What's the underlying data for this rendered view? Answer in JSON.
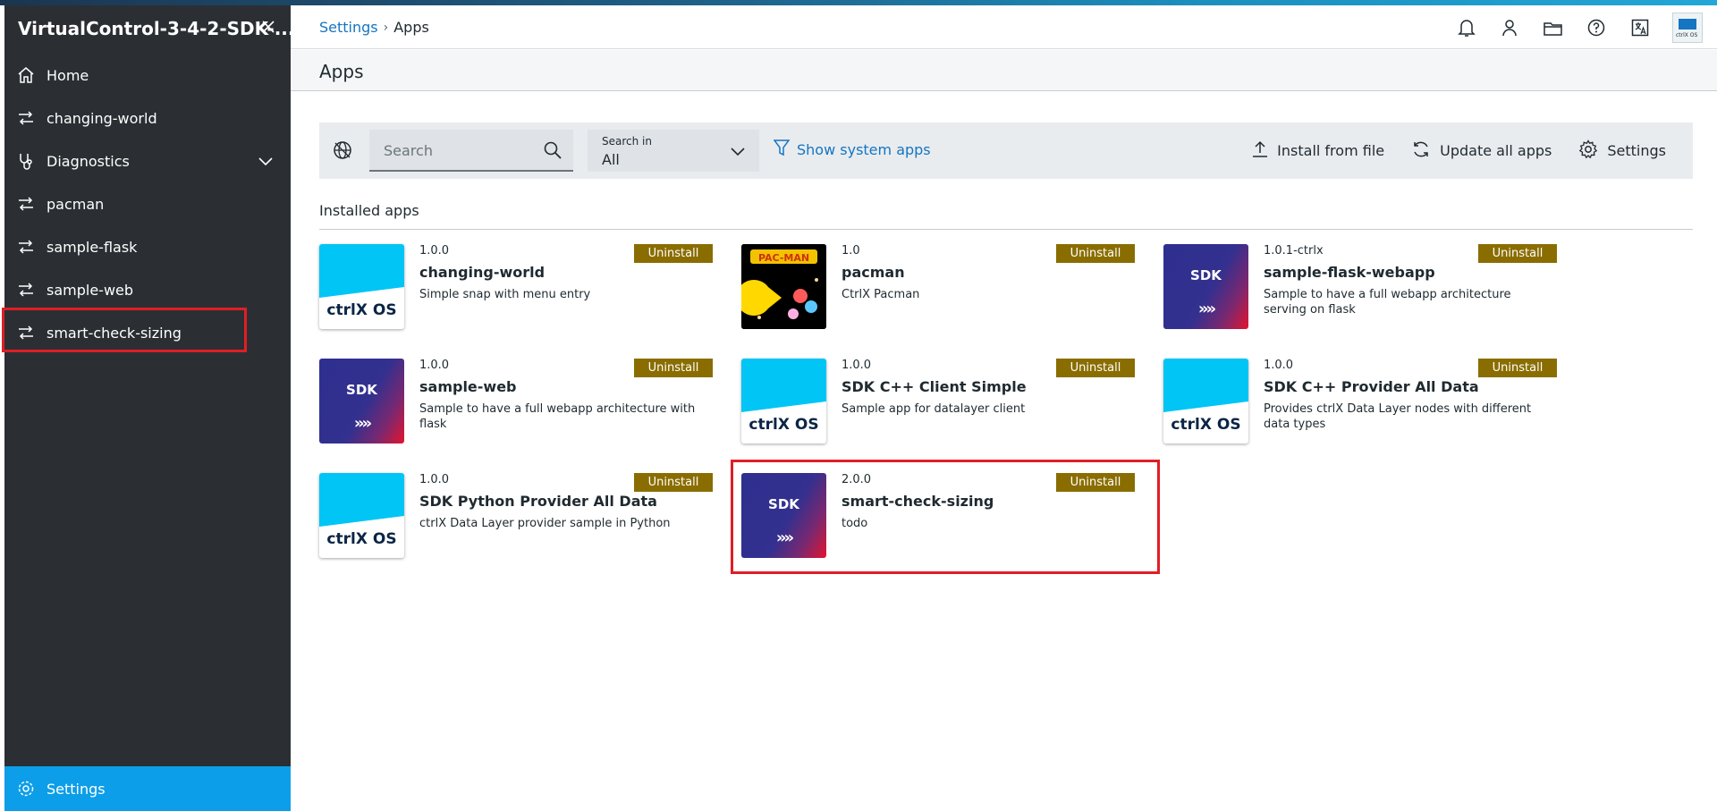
{
  "sidebar": {
    "title": "VirtualControl-3-4-2-SDK-...",
    "items": [
      {
        "label": "Home",
        "icon": "home-icon"
      },
      {
        "label": "changing-world",
        "icon": "app-icon"
      },
      {
        "label": "Diagnostics",
        "icon": "diagnostics-icon"
      },
      {
        "label": "pacman",
        "icon": "app-icon"
      },
      {
        "label": "sample-flask",
        "icon": "app-icon"
      },
      {
        "label": "sample-web",
        "icon": "app-icon"
      },
      {
        "label": "smart-check-sizing",
        "icon": "app-icon"
      }
    ],
    "settings_label": "Settings"
  },
  "header": {
    "breadcrumb_parent": "Settings",
    "breadcrumb_current": "Apps",
    "brand_text": "ctrlX OS"
  },
  "page": {
    "title": "Apps"
  },
  "toolbar": {
    "search_placeholder": "Search",
    "search_in_caption": "Search in",
    "search_in_value": "All",
    "show_system_apps": "Show system apps",
    "install_from_file": "Install from file",
    "update_all_apps": "Update all apps",
    "settings": "Settings"
  },
  "installed": {
    "heading": "Installed apps",
    "uninstall_label": "Uninstall",
    "apps": [
      {
        "version": "1.0.0",
        "name": "changing-world",
        "description": "Simple snap with menu entry",
        "logo": "ctrlx"
      },
      {
        "version": "1.0",
        "name": "pacman",
        "description": "CtrlX Pacman",
        "logo": "pacman"
      },
      {
        "version": "1.0.1-ctrlx",
        "name": "sample-flask-webapp",
        "description": "Sample to have a full webapp architecture serving on flask",
        "logo": "sdk"
      },
      {
        "version": "1.0.0",
        "name": "sample-web",
        "description": "Sample to have a full webapp architecture with flask",
        "logo": "sdk"
      },
      {
        "version": "1.0.0",
        "name": "SDK C++ Client Simple",
        "description": "Sample app for datalayer client",
        "logo": "ctrlx"
      },
      {
        "version": "1.0.0",
        "name": "SDK C++ Provider All Data",
        "description": "Provides ctrlX Data Layer nodes with different data types",
        "logo": "ctrlx"
      },
      {
        "version": "1.0.0",
        "name": "SDK Python Provider All Data",
        "description": "ctrlX Data Layer provider sample in Python",
        "logo": "ctrlx"
      },
      {
        "version": "2.0.0",
        "name": "smart-check-sizing",
        "description": "todo",
        "logo": "sdk"
      }
    ]
  },
  "logos": {
    "ctrlx_text": "ctrlX OS",
    "sdk_text": "SDK",
    "sdk_arrows": "»»",
    "pacman_text": "PAC-MAN"
  },
  "colors": {
    "sidebar_bg": "#2b2f33",
    "accent_blue": "#0c9ee8",
    "link_blue": "#1575c2",
    "uninstall_bg": "#8a6d00",
    "highlight_red": "#e01e25",
    "ctrlx_cyan": "#00c5f5"
  }
}
